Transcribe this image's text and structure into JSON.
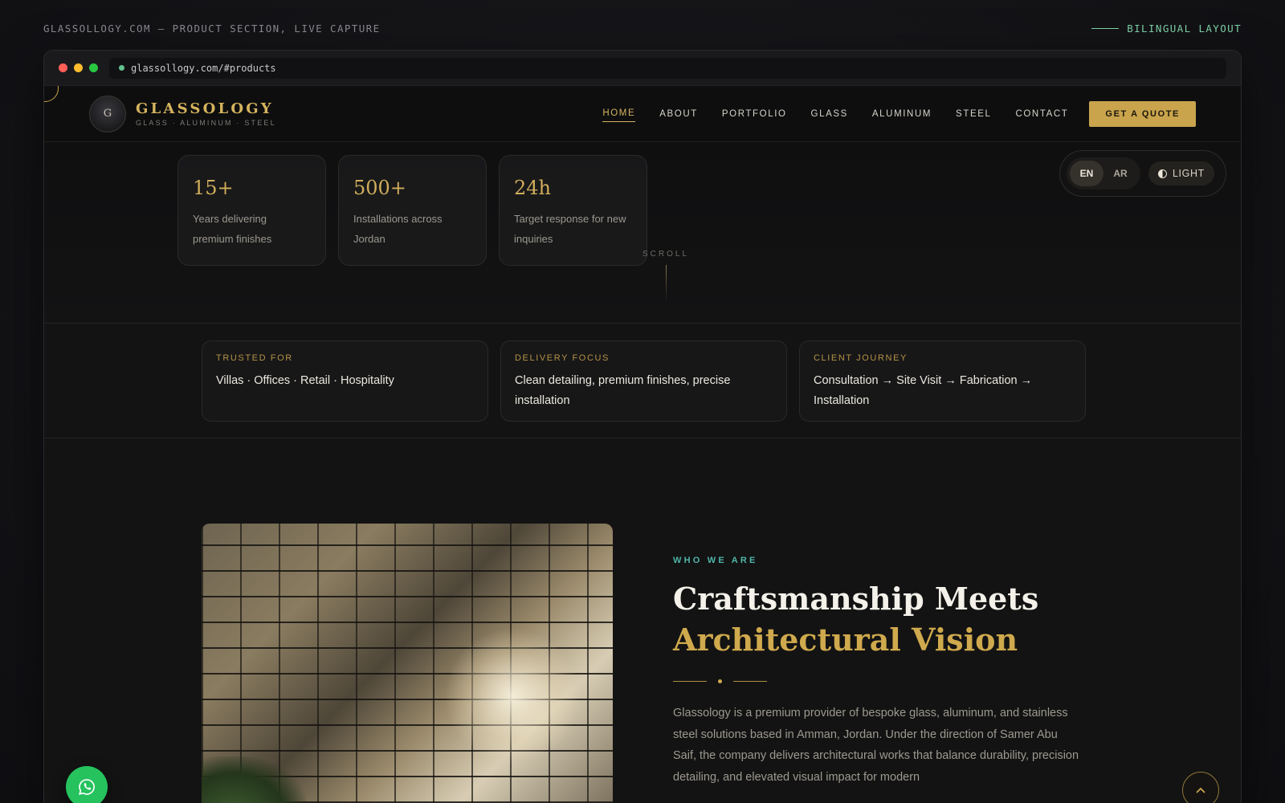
{
  "caption": "GLASSOLLOGY.COM — PRODUCT SECTION, LIVE CAPTURE",
  "layout_tag": "BILINGUAL LAYOUT",
  "browser": {
    "url": "glassollogy.com/#products"
  },
  "brand": {
    "name": "GLASSOLOGY",
    "tagline": "GLASS · ALUMINUM · STEEL",
    "mark": "G"
  },
  "nav": {
    "items": [
      {
        "label": "HOME",
        "active": true
      },
      {
        "label": "ABOUT"
      },
      {
        "label": "PORTFOLIO"
      },
      {
        "label": "GLASS"
      },
      {
        "label": "ALUMINUM"
      },
      {
        "label": "STEEL"
      },
      {
        "label": "CONTACT"
      }
    ],
    "cta": "GET A QUOTE"
  },
  "controls": {
    "lang_en": "EN",
    "lang_ar": "AR",
    "active_lang": "EN",
    "theme_label": "LIGHT"
  },
  "stats": [
    {
      "value": "15+",
      "text": "Years delivering premium finishes"
    },
    {
      "value": "500+",
      "text": "Installations across Jordan"
    },
    {
      "value": "24h",
      "text": "Target response for new inquiries"
    }
  ],
  "scroll_label": "SCROLL",
  "highlights": [
    {
      "label": "TRUSTED FOR",
      "text": "Villas · Offices · Retail · Hospitality"
    },
    {
      "label": "DELIVERY FOCUS",
      "text": "Clean detailing, premium finishes, precise installation"
    },
    {
      "label": "CLIENT JOURNEY",
      "text": "Consultation → Site Visit → Fabrication → Installation"
    }
  ],
  "about": {
    "eyebrow": "WHO WE ARE",
    "title_line1": "Craftsmanship Meets",
    "title_line2": "Architectural Vision",
    "body": "Glassology is a premium provider of bespoke glass, aluminum, and stainless steel solutions based in Amman, Jordan. Under the direction of Samer Abu Saif, the company delivers architectural works that balance durability, precision detailing, and elevated visual impact for modern"
  },
  "colors": {
    "accent_gold": "#c9a44c",
    "teal": "#4fb5a8",
    "whatsapp": "#25c25e",
    "background": "#131313"
  },
  "icons": {
    "whatsapp": "whatsapp-icon",
    "back_to_top": "chevron-up-icon",
    "theme": "half-moon-icon"
  }
}
